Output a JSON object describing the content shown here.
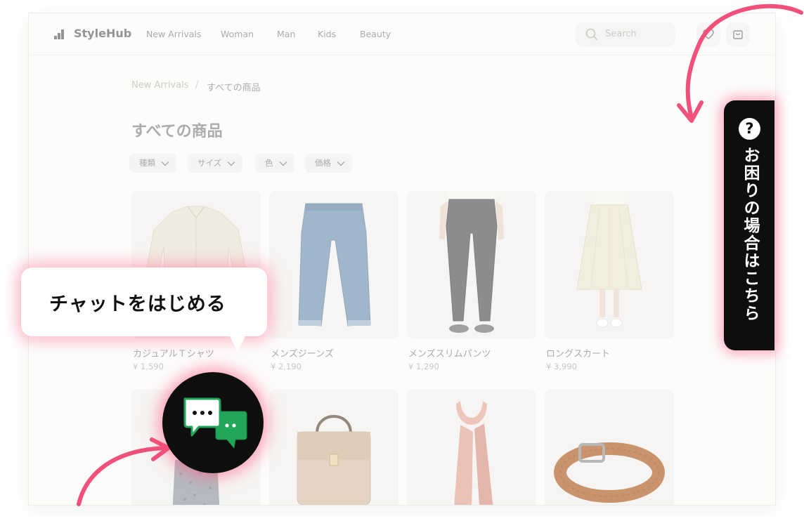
{
  "brand": {
    "name": "StyleHub",
    "logo_icon": "bar-chart-icon"
  },
  "nav": {
    "links": [
      "New Arrivals",
      "Woman",
      "Man",
      "Kids",
      "Beauty"
    ],
    "search_placeholder": "Search",
    "search_icon": "search-icon",
    "wishlist_icon": "heart-icon",
    "cart_icon": "bag-icon"
  },
  "breadcrumb": {
    "parent": "New Arrivals",
    "separator": "/",
    "current": "すべての商品"
  },
  "page_title": "すべての商品",
  "filters": [
    "種類",
    "サイズ",
    "色",
    "価格"
  ],
  "products": [
    {
      "name": "カジュアルＴシャツ",
      "price": "¥ 1,590",
      "image": "shirt"
    },
    {
      "name": "メンズジーンズ",
      "price": "¥ 2,190",
      "image": "jeans"
    },
    {
      "name": "メンズスリムパンツ",
      "price": "¥ 1,290",
      "image": "slim-pants"
    },
    {
      "name": "ロングスカート",
      "price": "¥ 3,990",
      "image": "long-skirt"
    },
    {
      "image": "patterned-dress"
    },
    {
      "image": "handbag"
    },
    {
      "image": "scarf"
    },
    {
      "image": "belt"
    }
  ],
  "help_tab": {
    "icon": "question-icon",
    "label": "お困りの場合はこちら"
  },
  "chat_bubble": {
    "text": "チャットをはじめる"
  },
  "chat_button": {
    "icon": "chat-icon"
  },
  "colors": {
    "accent_pink": "#f0507a",
    "chat_green": "#22a65a",
    "dark": "#0e0e0e"
  }
}
